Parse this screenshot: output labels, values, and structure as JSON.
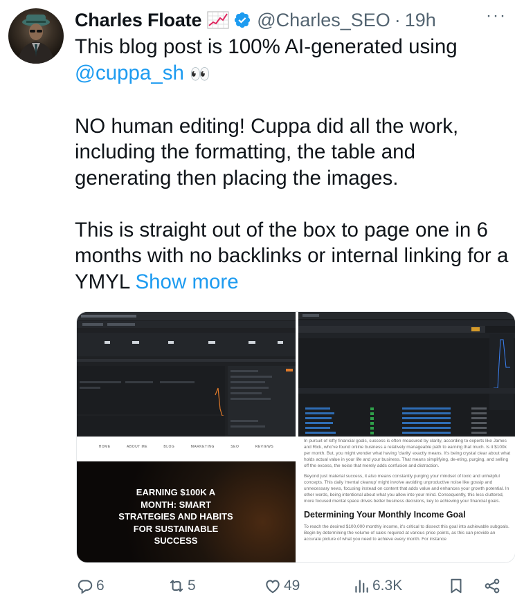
{
  "author": {
    "name": "Charles Floate",
    "handle": "@Charles_SEO",
    "separator": "·",
    "time": "19h",
    "avatar_icon": "avatar-gangster-fedora",
    "badge_icon": "chart-increasing-emoji",
    "verified_icon": "verified-badge",
    "verified_color": "#1d9bf0"
  },
  "tweet": {
    "line1": "This blog post is 100% AI-generated using",
    "mention": "@cuppa_sh",
    "eyes": "👀",
    "para2": "NO human editing! Cuppa did all the work, including the formatting, the table and generating then placing the images.",
    "para3": "This is straight out of the box to page one in 6 months with no backlinks or internal linking for a YMYL",
    "show_more": "Show more",
    "link_color": "#1d9bf0"
  },
  "media": {
    "nav_items": [
      "HOME",
      "ABOUT ME",
      "BLOG",
      "MARKETING",
      "SEO",
      "REVIEWS"
    ],
    "banner_title": "EARNING $100K A MONTH: SMART STRATEGIES AND HABITS FOR SUSTAINABLE SUCCESS",
    "article_para1": "In pursuit of lofty financial goals, success is often measured by clarity, according to experts like James and Rick, who've found online business a relatively manageable path to earning that much. Is it $100k per month. But, you might wonder what having 'clarity' exactly means. It's being crystal clear about what holds actual value in your life and your business. That means simplifying, de-eting, purging, and selling off the excess, the noise that merely adds confusion and distraction.",
    "article_para2": "Beyond just material success, it also means constantly purging your mindset of toxic and unhelpful concepts. This daily 'mental cleanup' might involve avoiding unproductive noise like gossip and unnecessary news, focusing instead on content that adds value and enhances your growth potential. In other words, being intentional about what you allow into your mind. Consequently, this less cluttered, more focused mental space drives better business decisions, key to achieving your financial goals.",
    "article_heading": "Determining Your Monthly Income Goal",
    "article_para3": "To reach the desired $100,000 monthly income, it's critical to dissect this goal into achievable subgoals. Begin by determining the volume of sales required at various price points, as this can provide an accurate picture of what you need to achieve every month. For instance"
  },
  "actions": {
    "replies": "6",
    "reposts": "5",
    "likes": "49",
    "views": "6.3K",
    "reply_icon": "reply-icon",
    "repost_icon": "repost-icon",
    "like_icon": "heart-icon",
    "views_icon": "analytics-icon",
    "bookmark_icon": "bookmark-icon",
    "share_icon": "share-icon"
  },
  "more_label": "···"
}
